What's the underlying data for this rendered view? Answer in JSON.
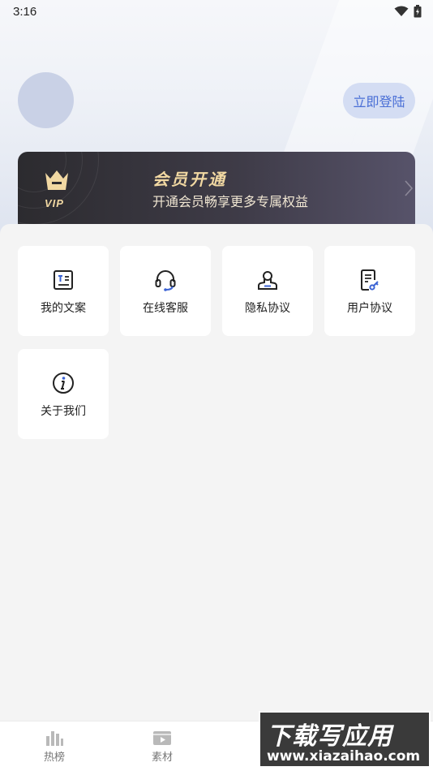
{
  "status_bar": {
    "time": "3:16",
    "icons": [
      "wifi-icon",
      "battery-charging-icon"
    ]
  },
  "profile": {
    "avatar": "avatar-placeholder",
    "login_label": "立即登陆"
  },
  "vip_banner": {
    "badge_text": "VIP",
    "title": "会员开通",
    "subtitle": "开通会员畅享更多专属权益",
    "accent": "#f1d8a2"
  },
  "menu": {
    "items": [
      {
        "label": "我的文案",
        "icon": "document-text-icon"
      },
      {
        "label": "在线客服",
        "icon": "headset-icon"
      },
      {
        "label": "隐私协议",
        "icon": "privacy-user-icon"
      },
      {
        "label": "用户协议",
        "icon": "user-agreement-icon"
      },
      {
        "label": "关于我们",
        "icon": "info-icon"
      }
    ]
  },
  "tabbar": {
    "tabs": [
      {
        "label": "热榜",
        "icon": "bar-chart-icon"
      },
      {
        "label": "素材",
        "icon": "video-material-icon"
      }
    ]
  },
  "watermark": {
    "main": "下载写应用",
    "url": "www.xiazaihao.com"
  }
}
